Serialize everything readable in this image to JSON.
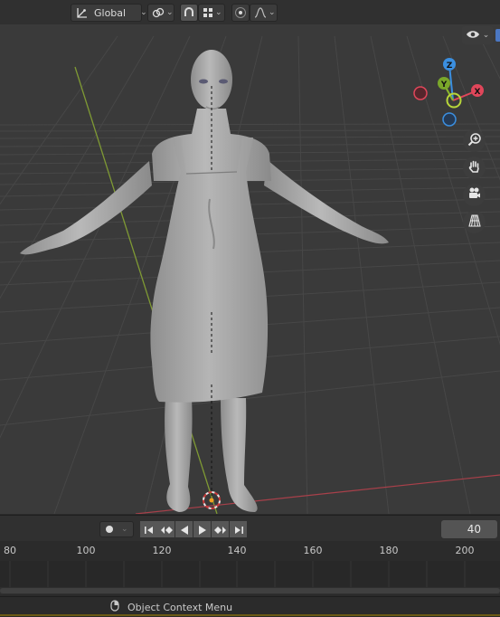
{
  "header": {
    "orientation_label": "Global",
    "icons": [
      "transform-orientation-icon",
      "pivot-icon",
      "snap-icon",
      "snap-grid-icon",
      "proportional-edit-icon",
      "falloff-icon"
    ]
  },
  "viewport": {
    "gizmo": {
      "x_label": "X",
      "y_label": "Y",
      "z_label": "Z"
    },
    "colors": {
      "x": "#e0465a",
      "y": "#8ab72d",
      "z": "#3b8fe0",
      "background": "#3a3a3a"
    },
    "nav_icons": [
      "zoom-icon",
      "hand-pan-icon",
      "camera-icon",
      "perspective-grid-icon"
    ]
  },
  "timeline": {
    "current_frame": "40",
    "ruler_labels": [
      "80",
      "100",
      "120",
      "140",
      "160",
      "180",
      "200"
    ],
    "playback_icons": [
      "jump-start-icon",
      "prev-keyframe-icon",
      "play-reverse-icon",
      "play-icon",
      "next-keyframe-icon",
      "jump-end-icon"
    ]
  },
  "statusbar": {
    "hint": "Object Context Menu"
  }
}
